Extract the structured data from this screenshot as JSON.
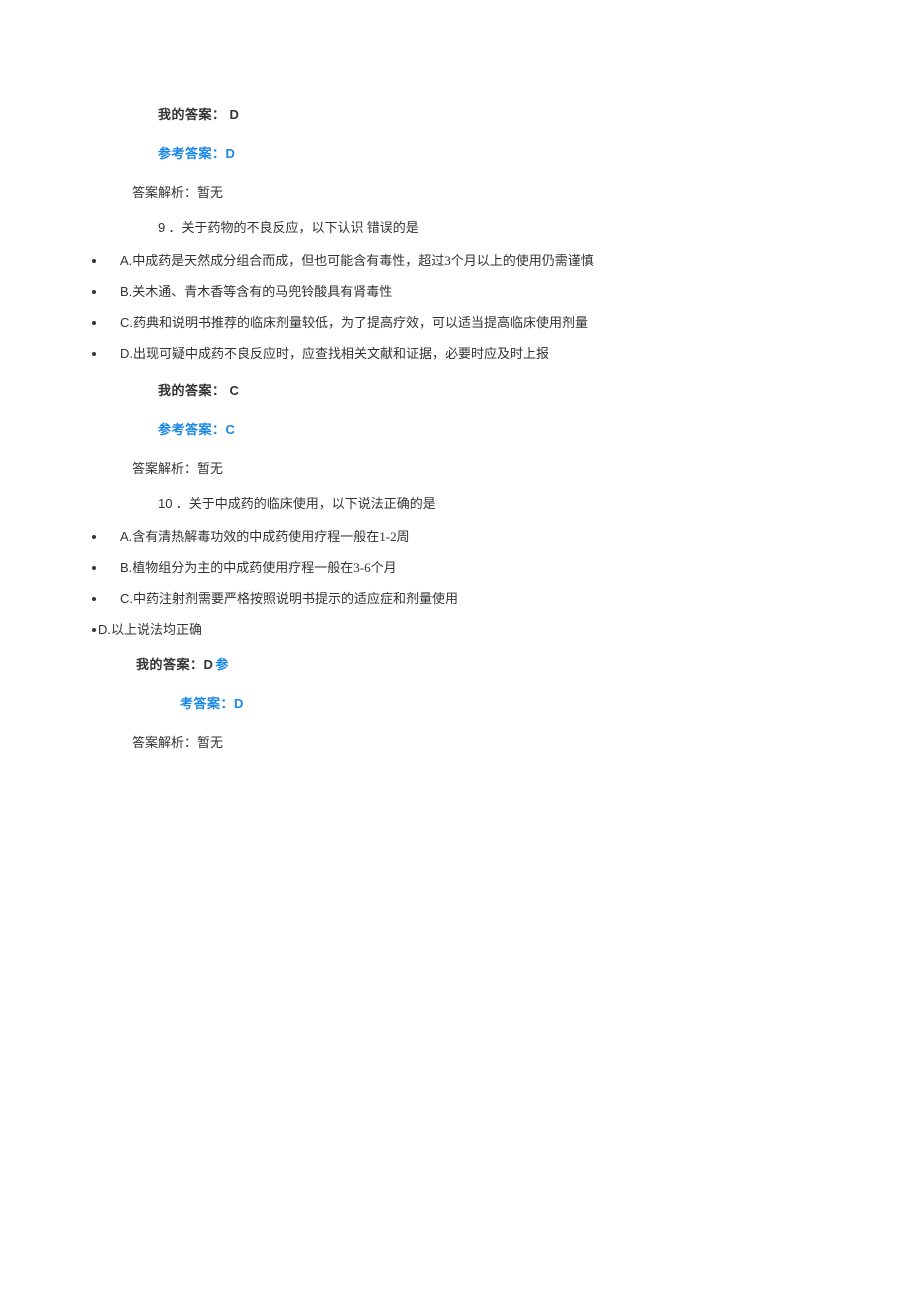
{
  "block1": {
    "my_answer_label": "我的答案：",
    "my_answer_value": "D",
    "ref_answer_label": "参考答案：",
    "ref_answer_value": "D",
    "explanation": "答案解析：暂无"
  },
  "question9": {
    "number": "9",
    "text": " ．关于药物的不良反应，以下认识  错误的是",
    "options": [
      {
        "letter": "A.",
        "text": "中成药是天然成分组合而成，但也可能含有毒性，超过3个月以上的使用仍需谨慎"
      },
      {
        "letter": "B.",
        "text": "关木通、青木香等含有的马兜铃酸具有肾毒性"
      },
      {
        "letter": "C.",
        "text": "药典和说明书推荐的临床剂量较低，为了提高疗效，可以适当提高临床使用剂量"
      },
      {
        "letter": "D.",
        "text": "出现可疑中成药不良反应时，应查找相关文献和证据，必要时应及时上报"
      }
    ],
    "my_answer_label": "我的答案：",
    "my_answer_value": "C",
    "ref_answer_label": "参考答案：",
    "ref_answer_value": "C",
    "explanation": "答案解析：暂无"
  },
  "question10": {
    "number": "10",
    "text": " ．关于中成药的临床使用，以下说法正确的是",
    "options": [
      {
        "letter": "A.",
        "text": "含有清热解毒功效的中成药使用疗程一般在1-2周"
      },
      {
        "letter": "B.",
        "text": "植物组分为主的中成药使用疗程一般在3-6个月"
      },
      {
        "letter": "C.",
        "text": "中药注射剂需要严格按照说明书提示的适应症和剂量使用"
      }
    ],
    "option_d": {
      "letter": "D.",
      "text": "以上说法均正确"
    },
    "my_answer_label": "我的答案：",
    "my_answer_value": "D",
    "ref_suffix": "参",
    "ref_answer_label": "考答案：",
    "ref_answer_value": "D",
    "explanation": "答案解析：暂无"
  }
}
